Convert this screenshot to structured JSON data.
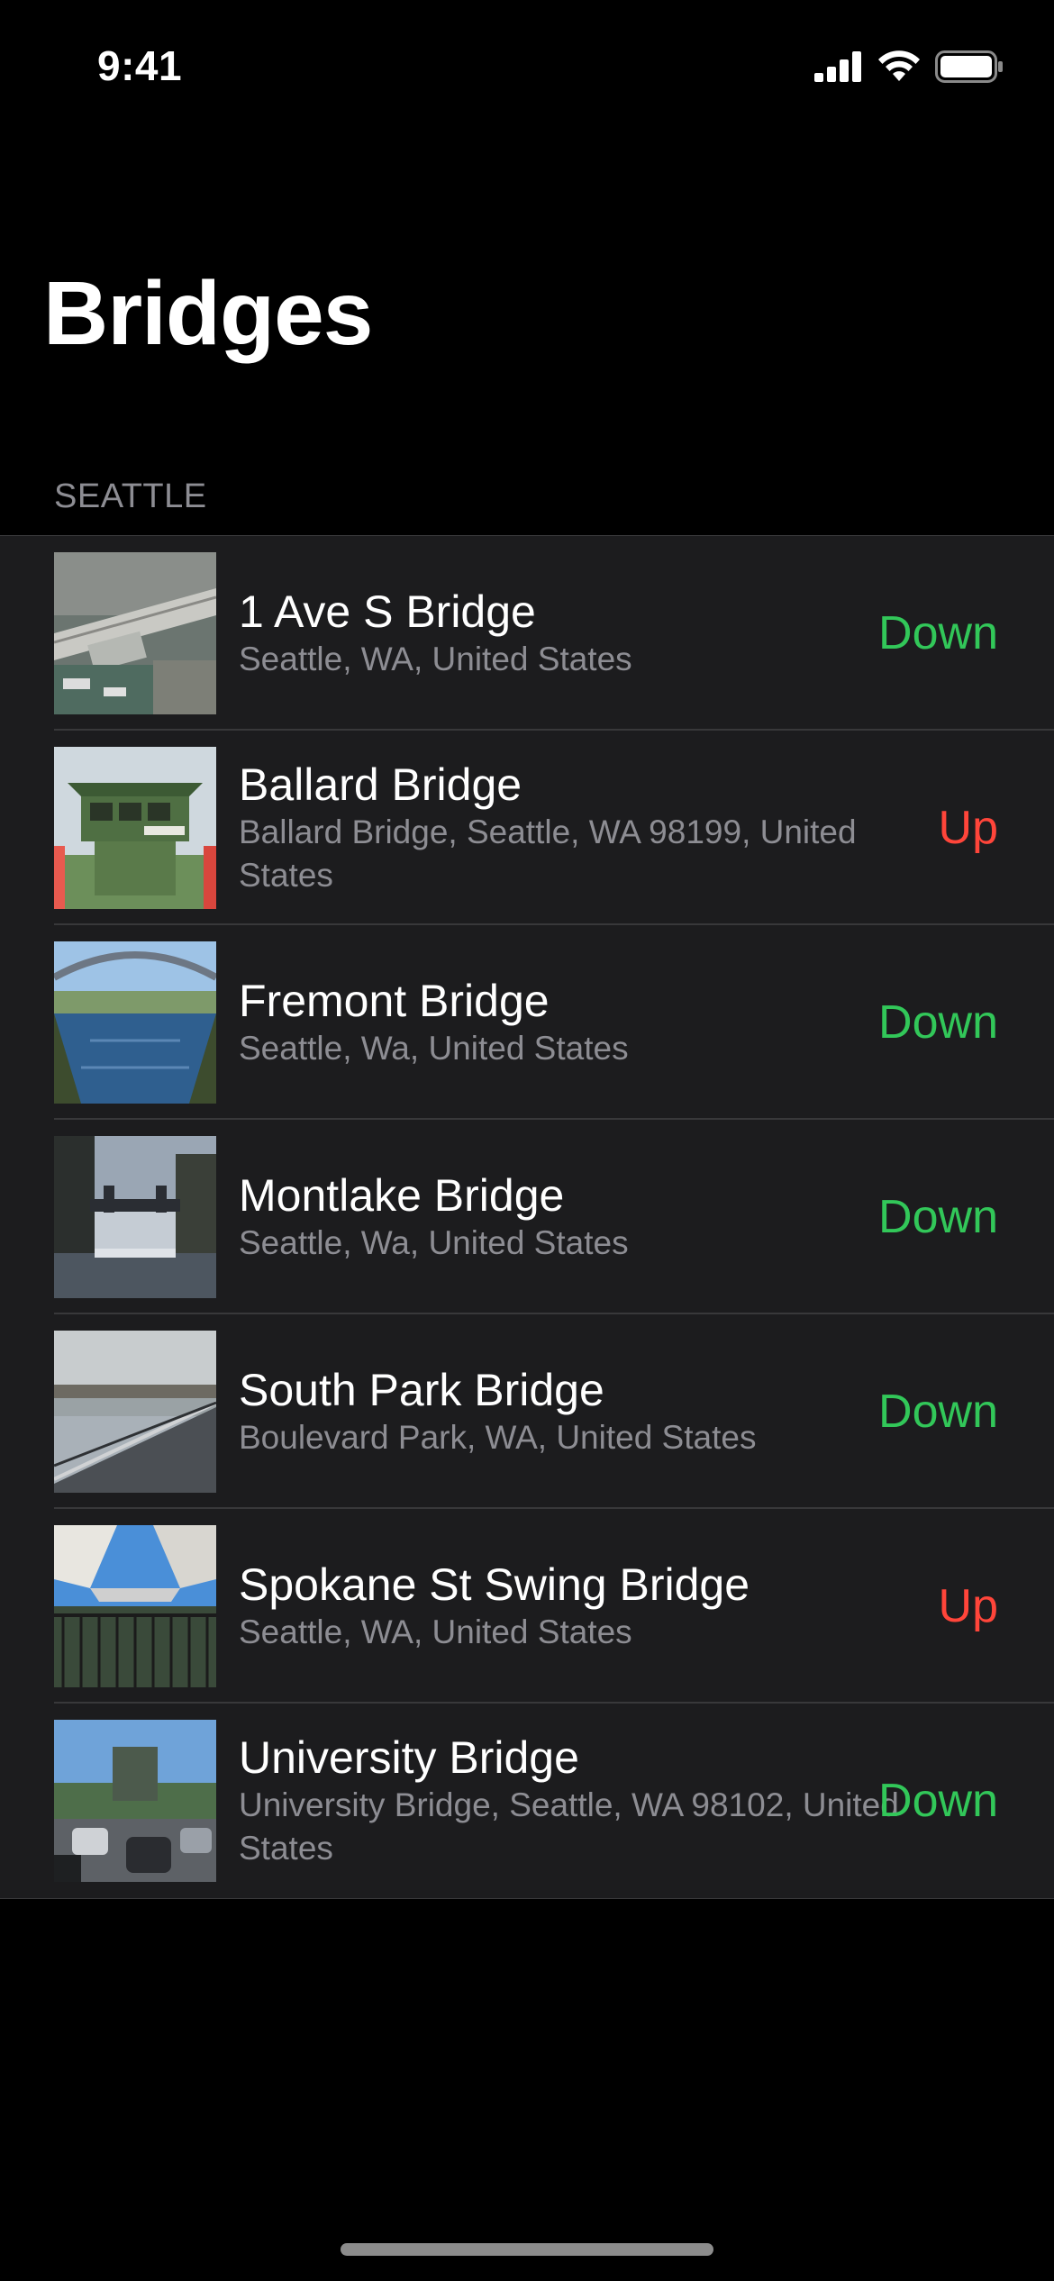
{
  "status_bar": {
    "time": "9:41",
    "icons": [
      "cellular-signal-icon",
      "wifi-icon",
      "battery-icon"
    ]
  },
  "title": "Bridges",
  "section": {
    "header": "SEATTLE"
  },
  "bridges": [
    {
      "name": "1 Ave S Bridge",
      "address": "Seattle, WA, United States",
      "status": "Down",
      "image": "bridge-aerial-photo"
    },
    {
      "name": "Ballard Bridge",
      "address": "Ballard Bridge, Seattle, WA 98199, United States",
      "status": "Up",
      "image": "bridge-control-tower-photo"
    },
    {
      "name": "Fremont Bridge",
      "address": "Seattle, Wa, United States",
      "status": "Down",
      "image": "bridge-canal-photo"
    },
    {
      "name": "Montlake Bridge",
      "address": "Seattle, Wa, United States",
      "status": "Down",
      "image": "bridge-cut-photo"
    },
    {
      "name": "South Park Bridge",
      "address": "Boulevard Park, WA, United States",
      "status": "Down",
      "image": "bridge-deck-photo"
    },
    {
      "name": "Spokane St Swing Bridge",
      "address": "Seattle, WA, United States",
      "status": "Up",
      "image": "bridge-underside-photo"
    },
    {
      "name": "University Bridge",
      "address": "University Bridge, Seattle, WA  98102, United States",
      "status": "Down",
      "image": "bridge-traffic-photo"
    }
  ],
  "colors": {
    "status_down": "#32c759",
    "status_up": "#ff453a",
    "background": "#000000",
    "cell_background": "#1c1c1e",
    "secondary_text": "#8d8d93"
  }
}
